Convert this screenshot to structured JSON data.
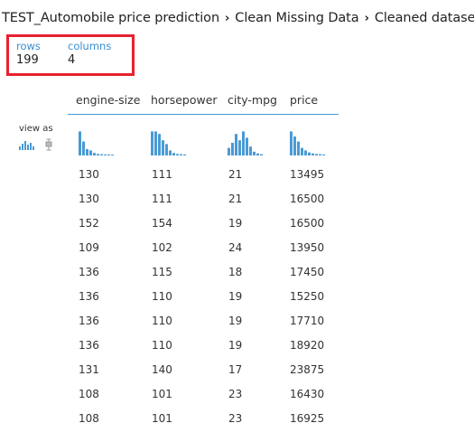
{
  "breadcrumb": {
    "items": [
      "TEST_Automobile price prediction",
      "Clean Missing Data",
      "Cleaned dataset"
    ],
    "separator": "›"
  },
  "summary": {
    "rows_label": "rows",
    "rows_value": "199",
    "columns_label": "columns",
    "columns_value": "4"
  },
  "view_as": {
    "label": "view as",
    "options": [
      "histogram-icon",
      "boxplot-icon"
    ]
  },
  "columns": [
    "engine-size",
    "horsepower",
    "city-mpg",
    "price"
  ],
  "histograms": {
    "engine-size": [
      0.95,
      0.55,
      0.25,
      0.2,
      0.1,
      0.06,
      0.05,
      0.04,
      0.04,
      0.03
    ],
    "horsepower": [
      0.95,
      0.95,
      0.85,
      0.6,
      0.45,
      0.2,
      0.1,
      0.06,
      0.05,
      0.04
    ],
    "city-mpg": [
      0.3,
      0.5,
      0.85,
      0.6,
      0.95,
      0.7,
      0.35,
      0.15,
      0.08,
      0.05
    ],
    "price": [
      0.95,
      0.75,
      0.55,
      0.3,
      0.2,
      0.12,
      0.08,
      0.06,
      0.05,
      0.04
    ]
  },
  "rows": [
    [
      "130",
      "111",
      "21",
      "13495"
    ],
    [
      "130",
      "111",
      "21",
      "16500"
    ],
    [
      "152",
      "154",
      "19",
      "16500"
    ],
    [
      "109",
      "102",
      "24",
      "13950"
    ],
    [
      "136",
      "115",
      "18",
      "17450"
    ],
    [
      "136",
      "110",
      "19",
      "15250"
    ],
    [
      "136",
      "110",
      "19",
      "17710"
    ],
    [
      "136",
      "110",
      "19",
      "18920"
    ],
    [
      "131",
      "140",
      "17",
      "23875"
    ],
    [
      "108",
      "101",
      "23",
      "16430"
    ],
    [
      "108",
      "101",
      "23",
      "16925"
    ]
  ],
  "colors": {
    "accent": "#3a8fd0",
    "highlight_box": "#e8212e",
    "histogram_bar": "#4a9ad4",
    "header_rule": "#4a9ad4"
  }
}
